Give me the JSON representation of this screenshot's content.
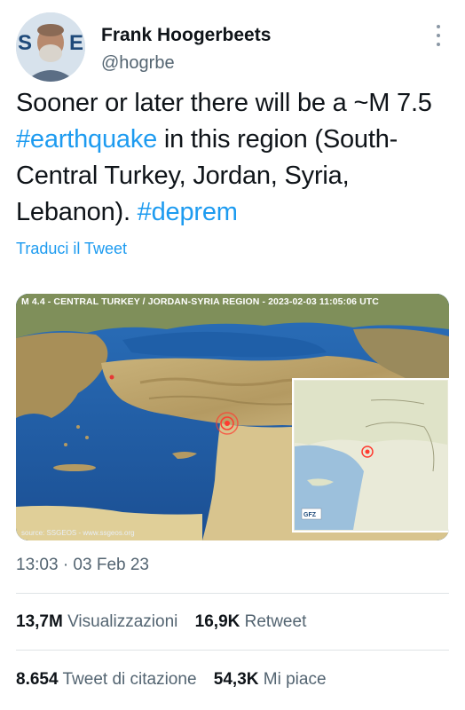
{
  "author": {
    "name": "Frank Hoogerbeets",
    "handle": "@hogrbe"
  },
  "tweet": {
    "text_1": "Sooner or later there will be a ~M 7.5 ",
    "hashtag_1": "#earthquake",
    "text_2": " in this region (South-Central Turkey, Jordan, Syria, Lebanon). ",
    "hashtag_2": "#deprem",
    "translate_label": "Traduci il Tweet"
  },
  "media": {
    "title": "M 4.4 - CENTRAL TURKEY / JORDAN-SYRIA REGION - 2023-02-03 11:05:06 UTC",
    "source": "source: SSGEOS - www.ssgeos.org",
    "inset_logo": "GFZ"
  },
  "meta": {
    "timestamp": "13:03 · 03 Feb 23"
  },
  "stats": {
    "views_count": "13,7M",
    "views_label": "Visualizzazioni",
    "retweets_count": "16,9K",
    "retweets_label": "Retweet",
    "quotes_count": "8.654",
    "quotes_label": "Tweet di citazione",
    "likes_count": "54,3K",
    "likes_label": "Mi piace"
  },
  "colors": {
    "link": "#1d9bf0",
    "secondary_text": "#536471",
    "primary_text": "#0f1419"
  }
}
